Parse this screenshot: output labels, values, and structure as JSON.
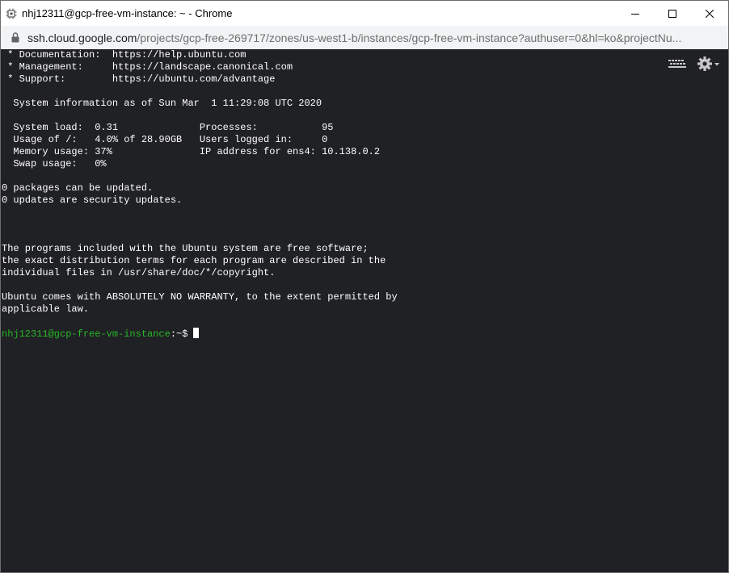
{
  "window": {
    "title": "nhj12311@gcp-free-vm-instance: ~ - Chrome"
  },
  "address": {
    "host": "ssh.cloud.google.com",
    "path": "/projects/gcp-free-269717/zones/us-west1-b/instances/gcp-free-vm-instance?authuser=0&hl=ko&projectNu..."
  },
  "terminal": {
    "lines": [
      " * Documentation:  https://help.ubuntu.com",
      " * Management:     https://landscape.canonical.com",
      " * Support:        https://ubuntu.com/advantage",
      "",
      "  System information as of Sun Mar  1 11:29:08 UTC 2020",
      "",
      "  System load:  0.31              Processes:           95",
      "  Usage of /:   4.0% of 28.90GB   Users logged in:     0",
      "  Memory usage: 37%               IP address for ens4: 10.138.0.2",
      "  Swap usage:   0%",
      "",
      "0 packages can be updated.",
      "0 updates are security updates.",
      "",
      "",
      "",
      "The programs included with the Ubuntu system are free software;",
      "the exact distribution terms for each program are described in the",
      "individual files in /usr/share/doc/*/copyright.",
      "",
      "Ubuntu comes with ABSOLUTELY NO WARRANTY, to the extent permitted by",
      "applicable law.",
      ""
    ],
    "prompt_user": "nhj12311@gcp-free-vm-instance",
    "prompt_dir": ":~$",
    "prompt_color": "#26b726",
    "background": "#202124"
  },
  "icons": {
    "app": "chip-icon",
    "lock": "lock-icon",
    "keyboard": "keyboard-icon",
    "settings": "gear-icon",
    "minimize": "minimize-icon",
    "maximize": "maximize-icon",
    "close": "close-icon"
  }
}
